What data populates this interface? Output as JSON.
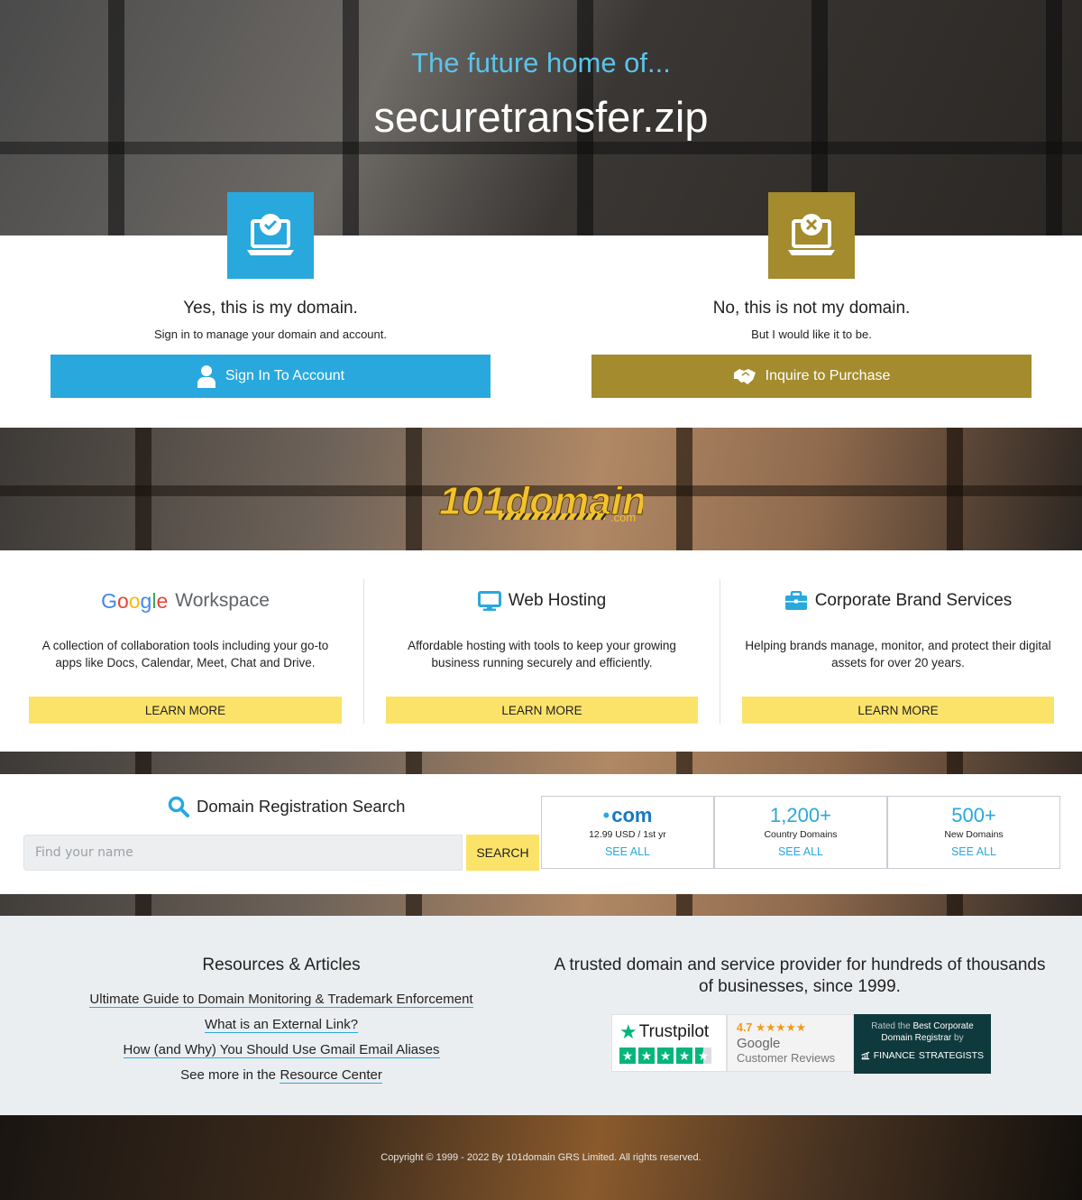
{
  "hero": {
    "subtitle": "The future home of...",
    "domain": "securetransfer.zip"
  },
  "owner_yes": {
    "heading": "Yes, this is my domain.",
    "text": "Sign in to manage your domain and account.",
    "button": "Sign In To Account",
    "icon": "laptop-check-icon",
    "color": "#29a8dd"
  },
  "owner_no": {
    "heading": "No, this is not my domain.",
    "text": "But I would like it to be.",
    "button": "Inquire to Purchase",
    "icon": "laptop-x-icon",
    "color": "#a38b2e"
  },
  "logo": {
    "main": "101domain",
    "suffix": ".com"
  },
  "services": [
    {
      "google_word": "Google",
      "title": "Workspace",
      "desc": "A collection of collaboration tools including your go-to apps like Docs, Calendar, Meet, Chat and Drive.",
      "button": "LEARN MORE"
    },
    {
      "title": "Web Hosting",
      "icon": "monitor-icon",
      "desc": "Affordable hosting with tools to keep your growing business running securely and efficiently.",
      "button": "LEARN MORE"
    },
    {
      "title": "Corporate Brand Services",
      "icon": "briefcase-icon",
      "desc": "Helping brands manage, monitor, and protect their digital assets for over 20 years.",
      "button": "LEARN MORE"
    }
  ],
  "search": {
    "title": "Domain Registration Search",
    "placeholder": "Find your name",
    "button": "SEARCH"
  },
  "stats": [
    {
      "big": "com",
      "small": "12.99 USD / 1st yr",
      "link": "SEE ALL"
    },
    {
      "big": "1,200+",
      "small": "Country Domains",
      "link": "SEE ALL"
    },
    {
      "big": "500+",
      "small": "New Domains",
      "link": "SEE ALL"
    }
  ],
  "resources": {
    "title": "Resources & Articles",
    "links": [
      "Ultimate Guide to Domain Monitoring & Trademark Enforcement",
      "What is an External Link?",
      "How (and Why) You Should Use Gmail Email Aliases"
    ],
    "more_prefix": "See more in the",
    "more_link": "Resource Center"
  },
  "trust": {
    "title": "A trusted domain and service provider for hundreds of thousands of businesses, since 1999.",
    "trustpilot": "Trustpilot",
    "google_rating": "4.7",
    "google_stars": "★★★★★",
    "google_name": "Google",
    "google_sub": "Customer Reviews",
    "fs_prefix": "Rated the",
    "fs_bold": "Best Corporate Domain Registrar",
    "fs_suffix": "by",
    "fs_company_1": "FINANCE",
    "fs_company_2": "STRATEGISTS"
  },
  "footer": {
    "copyright": "Copyright © 1999 - 2022 By 101domain GRS Limited. All rights reserved."
  },
  "colors": {
    "blue": "#29a8dd",
    "gold": "#a38b2e",
    "yellow_button": "#fbe36a"
  }
}
